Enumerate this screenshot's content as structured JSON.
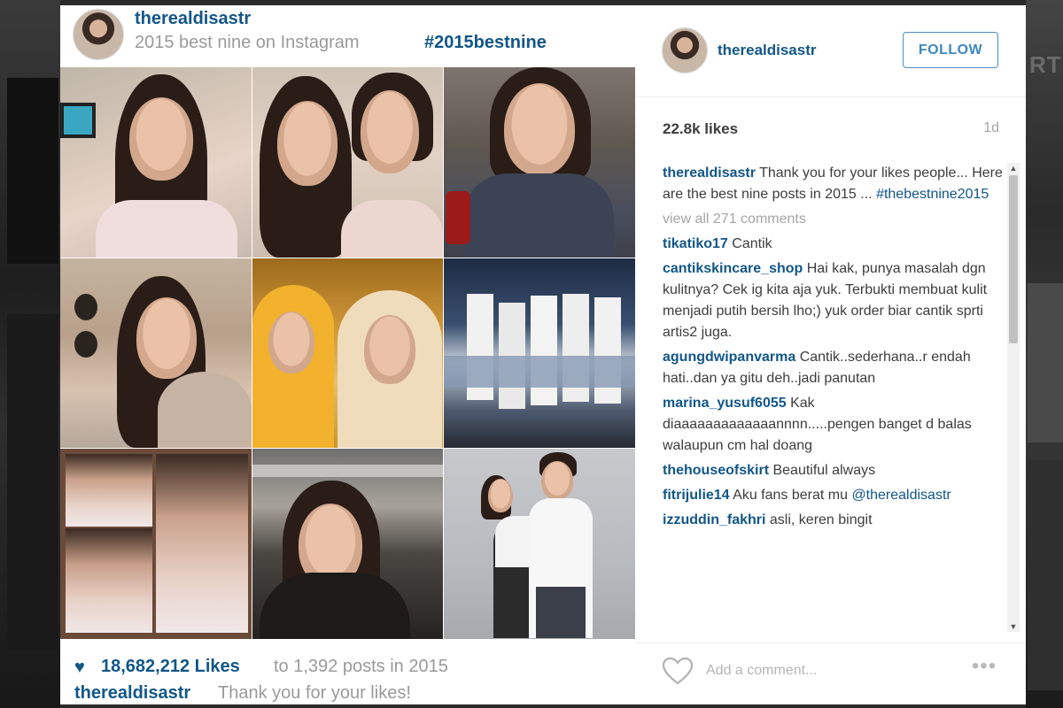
{
  "post": {
    "username": "therealdisastr",
    "caption": "2015 best nine on Instagram",
    "hashtag": "#2015bestnine",
    "likes_count": "18,682,212 Likes",
    "likes_rest": "to 1,392 posts in 2015",
    "footer_user": "therealdisastr",
    "footer_text": "Thank you for your likes!"
  },
  "side": {
    "username": "therealdisastr",
    "follow_label": "FOLLOW",
    "likes": "22.8k likes",
    "time": "1d",
    "add_comment_placeholder": "Add a comment...",
    "more_label": "•••"
  },
  "caption_comment": {
    "user": "therealdisastr",
    "text": "Thank you for your likes people... Here are the best nine posts in 2015 ...",
    "tag": "#thebestnine2015"
  },
  "view_all": "view all 271 comments",
  "comments": [
    {
      "user": "tikatiko17",
      "text": "Cantik"
    },
    {
      "user": "cantikskincare_shop",
      "text": "Hai kak, punya masalah dgn kulitnya? Cek ig kita aja yuk. Terbukti membuat kulit menjadi putih bersih lho;) yuk order biar cantik sprti artis2 juga."
    },
    {
      "user": "agungdwipanvarma",
      "text": "Cantik..sederhana..r endah hati..dan ya gitu deh..jadi panutan"
    },
    {
      "user": "marina_yusuf6055",
      "text": "Kak diaaaaaaaaaaaaannnn.....pengen banget d balas walaupun cm hal doang"
    },
    {
      "user": "thehouseofskirt",
      "text": "Beautiful always"
    },
    {
      "user": "fitrijulie14",
      "text": "Aku fans berat mu",
      "mention": "@therealdisastr"
    },
    {
      "user": "izzuddin_fakhri",
      "text": "asli, keren bingit"
    }
  ],
  "background": {
    "ghost_text": "RT"
  },
  "colors": {
    "link_blue": "#125688",
    "follow_blue": "#3f86bf",
    "muted_gray": "#9a9a9a"
  }
}
